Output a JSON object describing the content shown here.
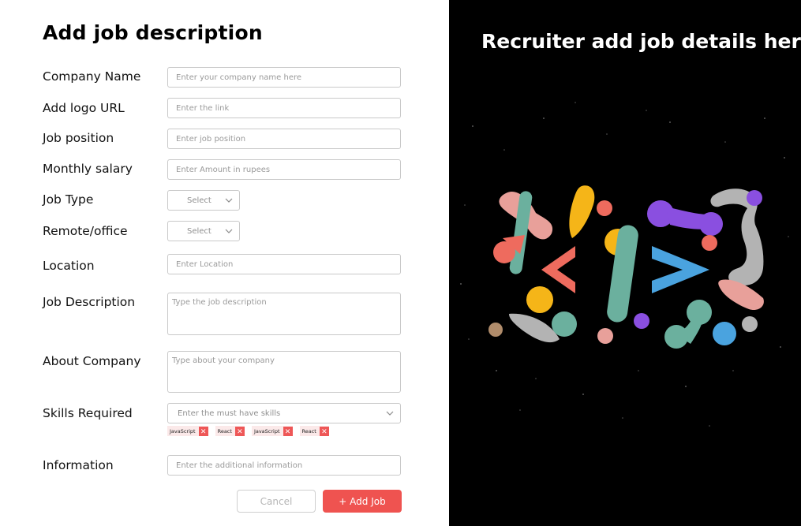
{
  "form": {
    "title": "Add job description",
    "fields": {
      "company_name": {
        "label": "Company Name",
        "placeholder": "Enter your company name here"
      },
      "logo_url": {
        "label": "Add logo URL",
        "placeholder": "Enter the link"
      },
      "job_position": {
        "label": "Job position",
        "placeholder": "Enter job position"
      },
      "monthly_salary": {
        "label": "Monthly salary",
        "placeholder": "Enter Amount in rupees"
      },
      "job_type": {
        "label": "Job Type",
        "selected": "Select"
      },
      "remote_office": {
        "label": "Remote/office",
        "selected": "Select"
      },
      "location": {
        "label": "Location",
        "placeholder": "Enter Location"
      },
      "job_description": {
        "label": "Job Description",
        "placeholder": "Type the job description"
      },
      "about_company": {
        "label": "About Company",
        "placeholder": "Type about your company"
      },
      "skills": {
        "label": "Skills Required",
        "placeholder": "Enter the must have skills",
        "tags": [
          "JavaScript",
          "React",
          "JavaScript",
          "React"
        ]
      },
      "information": {
        "label": "Information",
        "placeholder": "Enter the additional information"
      }
    },
    "buttons": {
      "cancel": "Cancel",
      "add_job": "+ Add Job"
    }
  },
  "side_panel": {
    "heading": "Recruiter add job details here",
    "illustration": "code-brackets-illustration"
  },
  "colors": {
    "add_button": "#ef5350",
    "tag_background": "#fbe9e9",
    "tag_remove": "#ee5757",
    "side_background": "#000000"
  }
}
